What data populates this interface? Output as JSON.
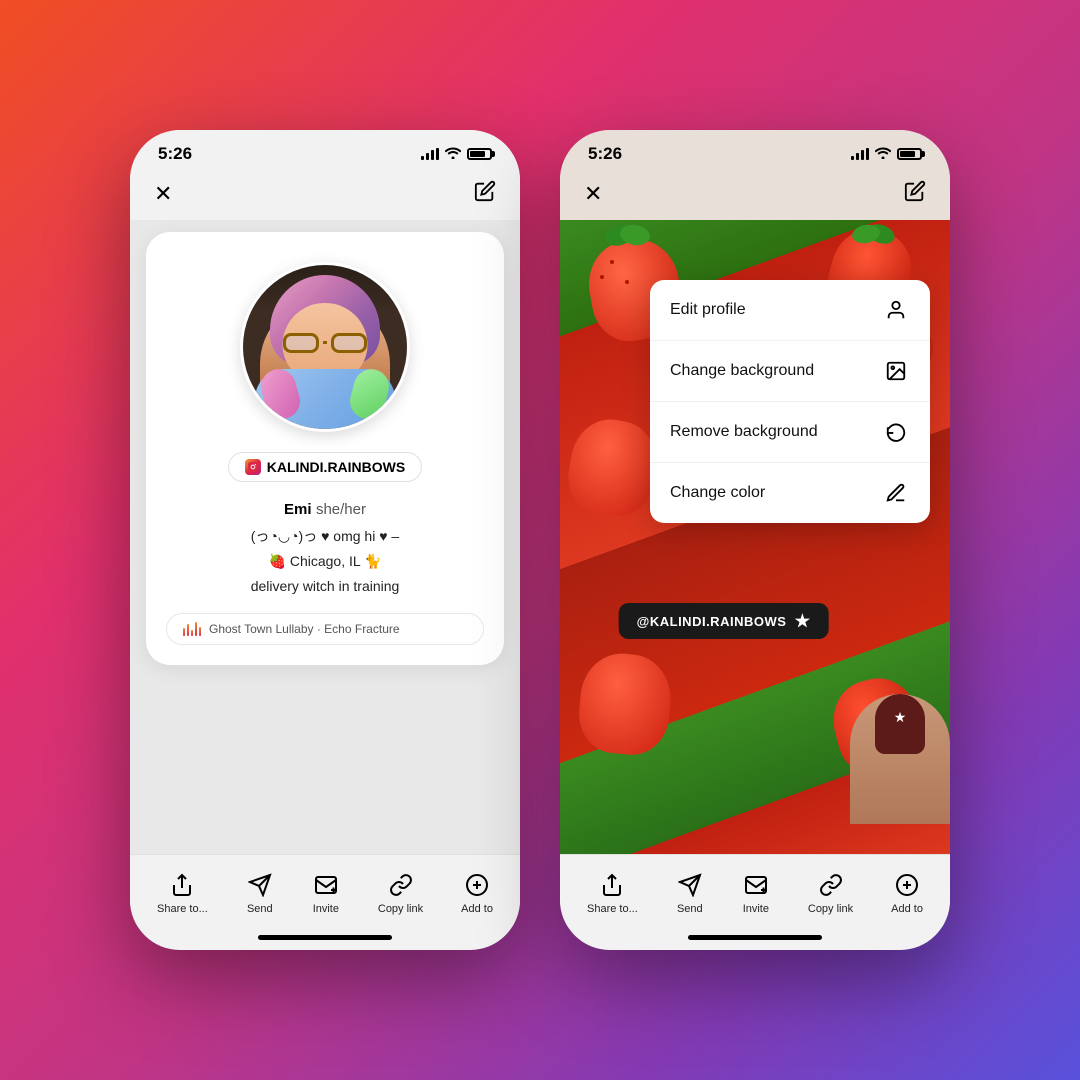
{
  "background": {
    "gradient": "linear-gradient(135deg, #f04e23 0%, #e1306c 30%, #c13584 55%, #833ab4 80%, #5851db 100%)"
  },
  "phone1": {
    "status": {
      "time": "5:26"
    },
    "nav": {
      "close": "✕",
      "edit": "✏"
    },
    "profile": {
      "username": "KALINDI.RAINBOWS",
      "name": "Emi",
      "pronoun": "she/her",
      "bio_line1": "(っ◔◡◔)っ ♥ omg hi ♥ –",
      "bio_line2": "🍓 Chicago, IL 🐈",
      "bio_line3": "delivery witch in training"
    },
    "music": {
      "text": "Ghost Town Lullaby · Echo Fracture"
    },
    "actions": {
      "share": "Share to...",
      "send": "Send",
      "invite": "Invite",
      "copy_link": "Copy link",
      "add_to": "Add to"
    }
  },
  "phone2": {
    "status": {
      "time": "5:26"
    },
    "nav": {
      "close": "✕",
      "edit": "✏"
    },
    "dropdown": {
      "items": [
        {
          "label": "Edit profile",
          "icon": "person"
        },
        {
          "label": "Change background",
          "icon": "image"
        },
        {
          "label": "Remove background",
          "icon": "undo"
        },
        {
          "label": "Change color",
          "icon": "pen"
        }
      ]
    },
    "qr": {
      "username": "@KALINDI.RAINBOWS"
    },
    "actions": {
      "share": "Share to...",
      "send": "Send",
      "invite": "Invite",
      "copy_link": "Copy link",
      "add_to": "Add to"
    }
  }
}
